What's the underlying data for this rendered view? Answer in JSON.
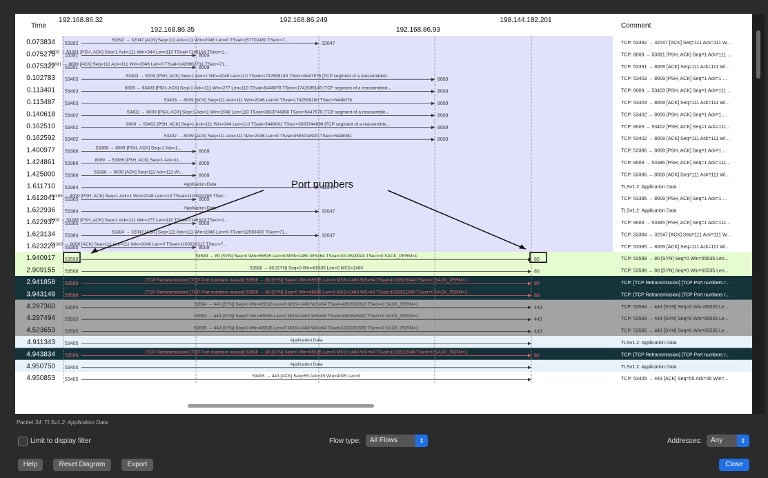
{
  "header": {
    "time_label": "Time",
    "comment_label": "Comment",
    "hosts": [
      "192.168.86.32",
      "192.168.86.35",
      "192.168.86.249",
      "192.168.86.93",
      "198.144.182.201"
    ]
  },
  "annotation": {
    "text": "Port numbers"
  },
  "rows": [
    {
      "time": "0.073834",
      "src_port": "53392",
      "dst_port": "32047",
      "label": "53392 → 32047 [ACK] Seq=111 Ack=111 Win=2046 Len=0 TSval=157702480 TSecr=7...",
      "comment": "TCP: 53392 → 32047 [ACK] Seq=111 Ack=111 W...",
      "style": "normal"
    },
    {
      "time": "0.075275",
      "src_port": "53391",
      "dst_port": "8009",
      "label": "8009 → 53391 [PSH, ACK] Seq=1 Ack=111 Win=344 Len=110 TSval=7146164 TSecr=1...",
      "comment": "TCP: 8009 → 53391 [PSH, ACK] Seq=1 Ack=111 ...",
      "style": "normal"
    },
    {
      "time": "0.075322",
      "src_port": "53391",
      "dst_port": "8009",
      "label": "53391 → 8009 [ACK] Seq=111 Ack=111 Win=2046 Len=0 TSval=1426802731 TSecr=71...",
      "comment": "TCP: 53391 → 8009 [ACK] Seq=111 Ack=111 Wi...",
      "style": "normal"
    },
    {
      "time": "0.102783",
      "src_port": "53403",
      "dst_port": "8009",
      "label": "53403 → 8009 [PSH, ACK] Seq=1 Ack=1 Win=2048 Len=110 TSval=1742599149 TSecr=5447576 [TCP segment of a reassembled...",
      "comment": "TCP: 53403 → 8009 [PSH, ACK] Seq=1 Ack=1 ...",
      "style": "normal"
    },
    {
      "time": "0.113401",
      "src_port": "53403",
      "dst_port": "8009",
      "label": "8009 → 53403 [PSH, ACK] Seq=1 Ack=111 Win=277 Len=110 TSval=5448078 TSecr=1742599149 [TCP segment of a reassembled...",
      "comment": "TCP: 8009 → 53403 [PSH, ACK] Seq=1 Ack=111 ...",
      "style": "normal"
    },
    {
      "time": "0.113487",
      "src_port": "53403",
      "dst_port": "8009",
      "label": "53403 → 8009 [ACK] Seq=111 Ack=111 Win=2046 Len=0 TSval=1742599160 TSecr=5448078",
      "comment": "TCP: 53403 → 8009 [ACK] Seq=111 Ack=111 Wi...",
      "style": "normal"
    },
    {
      "time": "0.140618",
      "src_port": "53402",
      "dst_port": "8009",
      "label": "53402 → 8009 [PSH, ACK] Seq=1 Ack=1 Win=2048 Len=110 TSval=3583744898 TSecr=5447579 [TCP segment of a reassemble...",
      "comment": "TCP: 53402 → 8009 [PSH, ACK] Seq=1 Ack=1 ...",
      "style": "normal"
    },
    {
      "time": "0.162510",
      "src_port": "53402",
      "dst_port": "8009",
      "label": "8009 → 53402 [PSH, ACK] Seq=1 Ack=111 Win=344 Len=110 TSval=5448081 TSecr=3583744898 [TCP segment of a reassemble...",
      "comment": "TCP: 8009 → 53402 [PSH, ACK] Seq=1 Ack=111...",
      "style": "normal"
    },
    {
      "time": "0.162592",
      "src_port": "53402",
      "dst_port": "8009",
      "label": "53402 → 8009 [ACK] Seq=111 Ack=111 Win=2046 Len=0 TSval=3583744920 TSecr=5448081",
      "comment": "TCP: 53402 → 8009 [ACK] Seq=111 Ack=111 Wi...",
      "style": "normal"
    },
    {
      "time": "1.400977",
      "src_port": "53386",
      "dst_port": "8009",
      "label": "53386 → 8009 [PSH, ACK] Seq=1 Ack=1...",
      "comment": "TCP: 53386 → 8009 [PSH, ACK] Seq=1 Ack=1 ...",
      "style": "normal"
    },
    {
      "time": "1.424861",
      "src_port": "53386",
      "dst_port": "8009",
      "label": "8009 → 53386 [PSH, ACK] Seq=1 Ack=11...",
      "comment": "TCP: 8009 → 53386 [PSH, ACK] Seq=1 Ack=111...",
      "style": "normal"
    },
    {
      "time": "1.425000",
      "src_port": "53386",
      "dst_port": "8009",
      "label": "53386 → 8009 [ACK] Seq=111 Ack=111 Wi...",
      "comment": "TCP: 53386 → 8009 [ACK] Seq=111 Ack=111 Wi...",
      "style": "normal"
    },
    {
      "time": "1.611710",
      "src_port": "53384",
      "dst_port": "32047",
      "label": "Application Data",
      "comment": "TLSv1.2: Application Data",
      "style": "normal"
    },
    {
      "time": "1.612041",
      "src_port": "53385",
      "dst_port": "8009",
      "label": "53385 → 8009 [PSH, ACK] Seq=1 Ack=1 Win=2048 Len=110 TSval=1100932306 TSec...",
      "comment": "TCP: 53385 → 8009 [PSH, ACK] Seq=1 Ack=1 ...",
      "style": "normal"
    },
    {
      "time": "1.622936",
      "src_port": "53384",
      "dst_port": "32047",
      "label": "Application Data",
      "comment": "TLSv1.2: Application Data",
      "style": "normal"
    },
    {
      "time": "1.622937",
      "src_port": "53385",
      "dst_port": "8009",
      "label": "8009 → 53385 [PSH, ACK] Seq=1 Ack=111 Win=277 Len=110 TSval=7146319 TSecr=1...",
      "comment": "TCP: 8009 → 53385 [PSH, ACK] Seq=1 Ack=111...",
      "style": "normal"
    },
    {
      "time": "1.623134",
      "src_port": "53384",
      "dst_port": "32047",
      "label": "53384 → 32047 [ACK] Seq=111 Ack=111 Win=2046 Len=0 TSval=12993400 TSecr=71...",
      "comment": "TCP: 53384 → 32047 [ACK] Seq=111 Ack=111 W...",
      "style": "normal"
    },
    {
      "time": "1.623220",
      "src_port": "53385",
      "dst_port": "8009",
      "label": "53385 → 8009 [ACK] Seq=111 Ack=111 Win=2046 Len=0 TSval=1100932317 TSecr=7...",
      "comment": "TCP: 53385 → 8009 [ACK] Seq=111 Ack=111 Wi...",
      "style": "normal"
    },
    {
      "time": "1.940917",
      "src_port": "53599",
      "dst_port": "80",
      "label": "53599 → 80 [SYN] Seq=0 Win=65535 Len=0 MSS=1460 WS=64 TSval=1010519043 TSecr=0 SACK_PERM=1",
      "comment": "TCP: 53599 → 80 [SYN] Seq=0 Win=65535 Len...",
      "style": "green"
    },
    {
      "time": "2.909155",
      "src_port": "53588",
      "dst_port": "80",
      "label": "53588 → 80 [SYN] Seq=0 Win=65535 Len=0 MSS=1460",
      "comment": "TCP: 53588 → 80 [SYN] Seq=0 Win=65535 Len...",
      "style": "green"
    },
    {
      "time": "2.941858",
      "src_port": "53599",
      "dst_port": "80",
      "label": "[TCP Retransmission] [TCP Port numbers reused] 53599 → 80 [SYN] Seq=0 Win=65535 Len=0 MSS=1460 WS=64 TSval=1010520044 TSecr=0 SACK_PERM=1",
      "comment": "TCP: [TCP Retransmission] [TCP Port numbers r...",
      "style": "dark"
    },
    {
      "time": "3.943149",
      "src_port": "53599",
      "dst_port": "80",
      "label": "[TCP Retransmission] [TCP Port numbers reused] 53599 → 80 [SYN] Seq=0 Win=65535 Len=0 MSS=1460 WS=64 TSval=1010521045 TSecr=0 SACK_PERM=1",
      "comment": "TCP: [TCP Retransmission] [TCP Port numbers r...",
      "style": "dark"
    },
    {
      "time": "4.297360",
      "src_port": "53594",
      "dst_port": "443",
      "label": "53594 → 443 [SYN] Seq=0 Win=65535 Len=0 MSS=1460 WS=64 TSval=4260592918 TSecr=0 SACK_PERM=1",
      "comment": "TCP: 53594 → 443 [SYN] Seq=0 Win=65535 Le...",
      "style": "gray"
    },
    {
      "time": "4.297494",
      "src_port": "53593",
      "dst_port": "443",
      "label": "53593 → 443 [SYN] Seq=0 Win=65535 Len=0 MSS=1460 WS=64 TSval=3393645047 TSecr=0 SACK_PERM=1",
      "comment": "TCP: 53593 → 443 [SYN] Seq=0 Win=65535 Le...",
      "style": "gray"
    },
    {
      "time": "4.523653",
      "src_port": "53595",
      "dst_port": "443",
      "label": "53595 → 443 [SYN] Seq=0 Win=65535 Len=0 MSS=1460 WS=64 TSval=1331802595 TSecr=0 SACK_PERM=1",
      "comment": "TCP: 53595 → 443 [SYN] Seq=0 Win=65535 Le...",
      "style": "gray"
    },
    {
      "time": "4.911343",
      "src_port": "53405",
      "dst_port": "",
      "label": "Application Data",
      "comment": "TLSv1.2: Application Data",
      "style": "lightblue"
    },
    {
      "time": "4.943834",
      "src_port": "53599",
      "dst_port": "80",
      "label": "[TCP Retransmission] [TCP Port numbers reused] 53599 → 80 [SYN] Seq=0 Win=65535 Len=0 MSS=1460 WS=64 TSval=1010522046 TSecr=0 SACK_PERM=1",
      "comment": "TCP: [TCP Retransmission] [TCP Port numbers r...",
      "style": "dark"
    },
    {
      "time": "4.950750",
      "src_port": "53405",
      "dst_port": "",
      "label": "Application Data",
      "comment": "TLSv1.2: Application Data",
      "style": "lightblue"
    },
    {
      "time": "4.950853",
      "src_port": "53405",
      "dst_port": "",
      "label": "53405 → 443 [ACK] Seq=55 Ack=35 Win=4095 Len=0",
      "comment": "TCP: 53405 → 443 [ACK] Seq=55 Ack=35 Win=...",
      "style": "white"
    }
  ],
  "status": {
    "packet_text": "Packet 34: TLSv1.2: Application Data"
  },
  "controls": {
    "limit_filter_label": "Limit to display filter",
    "flow_type_label": "Flow type:",
    "flow_type_value": "All Flows",
    "addresses_label": "Addresses:",
    "addresses_value": "Any",
    "help_label": "Help",
    "reset_label": "Reset Diagram",
    "export_label": "Export",
    "close_label": "Close"
  },
  "colors": {
    "flow_bg": "#e1e1fb",
    "green": "#e6fcd0",
    "dark": "#13323a",
    "gray": "#a3a3a3",
    "lightblue": "#e8f2fb",
    "retrans_text": "#ff6b6b",
    "accent": "#1f6fe5"
  }
}
